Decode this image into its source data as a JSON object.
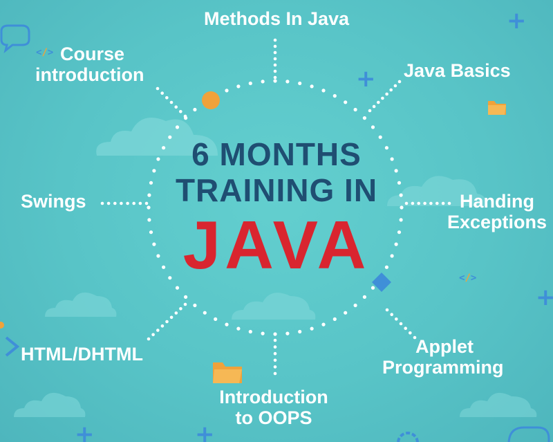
{
  "title": {
    "line1": "6 MONTHS",
    "line2": "TRAINING IN",
    "line3": "JAVA"
  },
  "topics": {
    "methods": "Methods In Java",
    "course_line1": "Course",
    "course_line2": "introduction",
    "basics": "Java Basics",
    "swings": "Swings",
    "exceptions_line1": "Handing",
    "exceptions_line2": "Exceptions",
    "html": "HTML/DHTML",
    "applet_line1": "Applet",
    "applet_line2": "Programming",
    "oops_line1": "Introduction",
    "oops_line2": "to OOPS"
  },
  "colors": {
    "background": "#58c4c7",
    "title_dark": "#1f4e72",
    "title_red": "#d9252f",
    "dots": "#ffffff",
    "accent_blue": "#3f8fd8",
    "accent_orange": "#f0a23a"
  },
  "icons": [
    "chat-bubble-icon",
    "code-tag-icon",
    "plus-icon",
    "folder-icon",
    "diamond-icon",
    "orange-dot-icon",
    "cloud-icon",
    "gear-icon",
    "chevron-right-icon"
  ]
}
